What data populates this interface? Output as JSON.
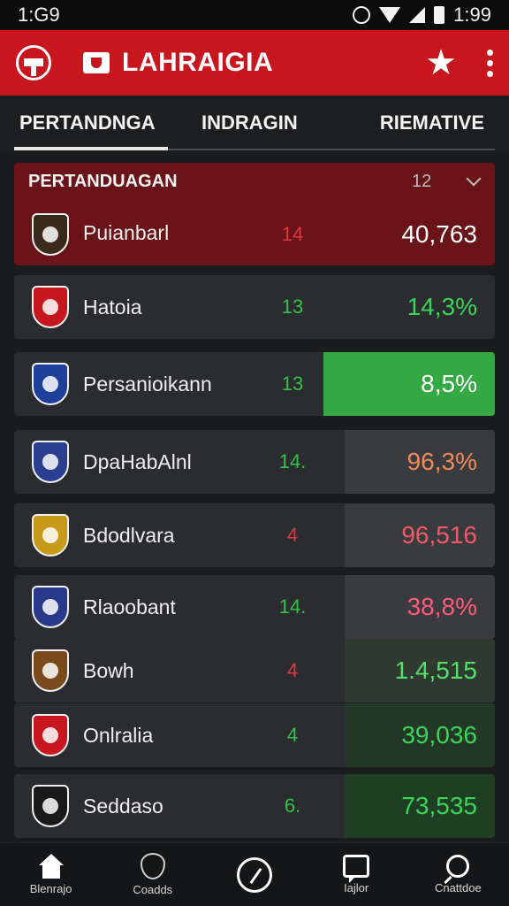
{
  "status_bar": {
    "time_left": "1:G9",
    "time_right": "1:99"
  },
  "app_bar": {
    "title": "LAHRAIGIA"
  },
  "tabs": [
    {
      "label": "PERTANDNGA",
      "active": true
    },
    {
      "label": "INDRAGIN",
      "active": false
    },
    {
      "label": "RIEMATIVE",
      "active": false
    }
  ],
  "list_header": {
    "title": "PERTANDUAGAN",
    "count": "12"
  },
  "rows": [
    {
      "name": "Puianbarl",
      "num": "14",
      "value": "40,763",
      "num_color": "#e0363d",
      "value_color": "#ffffff",
      "box_color": "transparent",
      "crest_color": "#3a2a1c"
    },
    {
      "name": "Hatoia",
      "num": "13",
      "value": "14,3%",
      "num_color": "#35c24a",
      "value_color": "#3bd45a",
      "box_color": "transparent",
      "crest_color": "#c8161f"
    },
    {
      "name": "Persanioikann",
      "num": "13",
      "value": "8,5%",
      "num_color": "#35c24a",
      "value_color": "#ffffff",
      "box_color": "#33a843",
      "crest_color": "#1e3f9a"
    },
    {
      "name": "DpaHabAlnl",
      "num": "14.",
      "value": "96,3%",
      "num_color": "#35c24a",
      "value_color": "#f08a5a",
      "box_color": "#3a3b3e",
      "crest_color": "#2a3f8f"
    },
    {
      "name": "Bdodlvara",
      "num": "4",
      "value": "96,516",
      "num_color": "#e0363d",
      "value_color": "#ef5a6a",
      "box_color": "#3a3b3e",
      "crest_color": "#c89a1a"
    },
    {
      "name": "Rlaoobant",
      "num": "14.",
      "value": "38,8%",
      "num_color": "#35c24a",
      "value_color": "#ff5a7a",
      "box_color": "#3a3b3e",
      "crest_color": "#2a3a8a"
    },
    {
      "name": "Bowh",
      "num": "4",
      "value": "1.4,515",
      "num_color": "#e0363d",
      "value_color": "#55e06a",
      "box_color": "#2f3a31",
      "crest_color": "#7a4a1a"
    },
    {
      "name": "Onlralia",
      "num": "4",
      "value": "39,036",
      "num_color": "#35c24a",
      "value_color": "#3bd45a",
      "box_color": "#233826",
      "crest_color": "#c8161f"
    },
    {
      "name": "Seddaso",
      "num": "6.",
      "value": "73,535",
      "num_color": "#35c24a",
      "value_color": "#3bd45a",
      "box_color": "#1f3f25",
      "crest_color": "#1a1a1a"
    }
  ],
  "bottom_nav": [
    {
      "label": "Blenrajo",
      "icon": "home-icon"
    },
    {
      "label": "Coadds",
      "icon": "shield-icon"
    },
    {
      "label": "",
      "icon": "compass-icon"
    },
    {
      "label": "Iajlor",
      "icon": "chat-icon"
    },
    {
      "label": "Cnattdoe",
      "icon": "search-icon"
    }
  ],
  "colors": {
    "accent": "#c8161f",
    "background": "#1b1c1e",
    "row": "#2a2c2f",
    "header_row": "#6a1419"
  }
}
